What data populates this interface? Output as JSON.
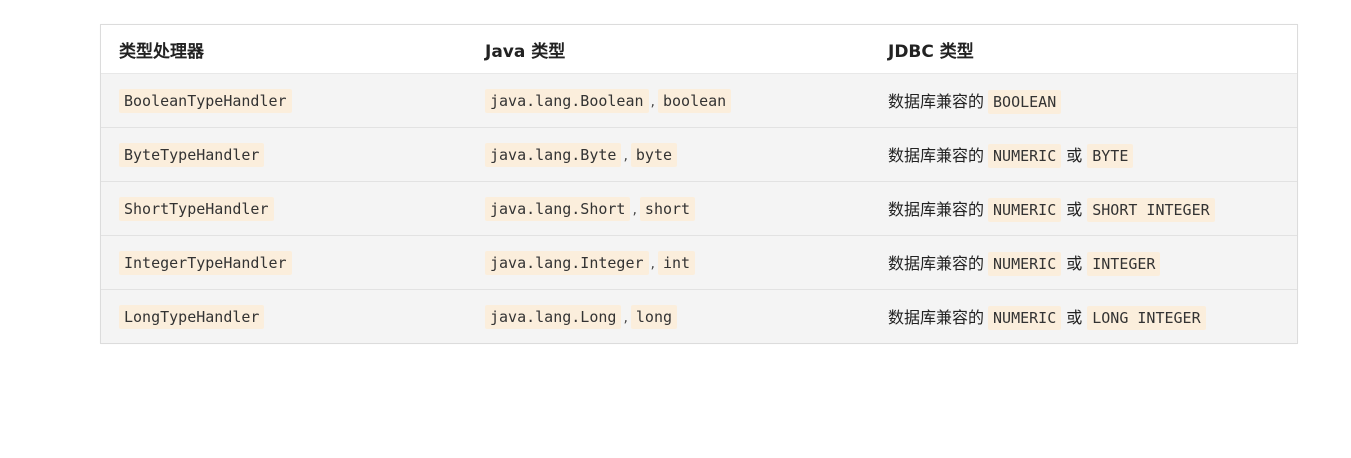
{
  "table": {
    "headers": [
      "类型处理器",
      "Java 类型",
      "JDBC 类型"
    ],
    "separator": ",",
    "jdbc_prefix": "数据库兼容的",
    "or_word": "或",
    "rows": [
      {
        "handler": "BooleanTypeHandler",
        "java": [
          "java.lang.Boolean",
          "boolean"
        ],
        "jdbc": [
          "BOOLEAN"
        ]
      },
      {
        "handler": "ByteTypeHandler",
        "java": [
          "java.lang.Byte",
          "byte"
        ],
        "jdbc": [
          "NUMERIC",
          "BYTE"
        ]
      },
      {
        "handler": "ShortTypeHandler",
        "java": [
          "java.lang.Short",
          "short"
        ],
        "jdbc": [
          "NUMERIC",
          "SHORT INTEGER"
        ]
      },
      {
        "handler": "IntegerTypeHandler",
        "java": [
          "java.lang.Integer",
          "int"
        ],
        "jdbc": [
          "NUMERIC",
          "INTEGER"
        ]
      },
      {
        "handler": "LongTypeHandler",
        "java": [
          "java.lang.Long",
          "long"
        ],
        "jdbc": [
          "NUMERIC",
          "LONG INTEGER"
        ]
      }
    ]
  },
  "colors": {
    "code_background": "#fbeedc",
    "row_background": "#f4f4f4",
    "header_background": "#ffffff",
    "border": "#dcdcdc"
  }
}
